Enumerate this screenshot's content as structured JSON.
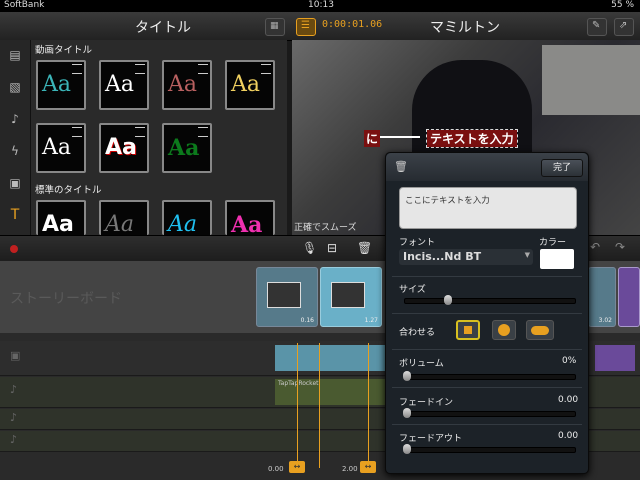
{
  "status": {
    "carrier": "SoftBank",
    "time": "10:13",
    "battery": "55 %"
  },
  "header": {
    "left_title": "タイトル",
    "right_title": "マミルトン",
    "timecode": "0:00:01.06"
  },
  "browser": {
    "section_moving": "動画タイトル",
    "section_standard": "標準のタイトル",
    "thumbs_row1": [
      "Aa",
      "Aa",
      "Aa",
      "Aa"
    ],
    "thumbs_row2": [
      "Aa",
      "Aa",
      "Aa"
    ],
    "thumbs_row3": [
      "Aa",
      "Aa",
      "Aa",
      "Aa"
    ]
  },
  "preview": {
    "overlay_prefix": "に",
    "overlay_text": "テキストを入力",
    "caption": "正確でスムーズ"
  },
  "storyboard": {
    "label": "ストーリーボード",
    "clip_durations": [
      "0.16",
      "1.27",
      "3.02"
    ]
  },
  "timeline": {
    "audio_label": "TapTapRocket",
    "ruler": [
      "0.00",
      "2.00"
    ]
  },
  "popup": {
    "done": "完了",
    "text_value": "ここにテキストを入力",
    "font_label": "フォント",
    "font_value": "Incis...Nd BT",
    "color_label": "カラー",
    "size_label": "サイズ",
    "size_level": 0.25,
    "fit_label": "合わせる",
    "volume_label": "ボリューム",
    "volume_value": "0%",
    "fadein_label": "フェードイン",
    "fadein_value": "0.00",
    "fadeout_label": "フェードアウト",
    "fadeout_value": "0.00"
  },
  "colors": {
    "accent": "#e8a020",
    "selected_border": "#d8c020"
  }
}
